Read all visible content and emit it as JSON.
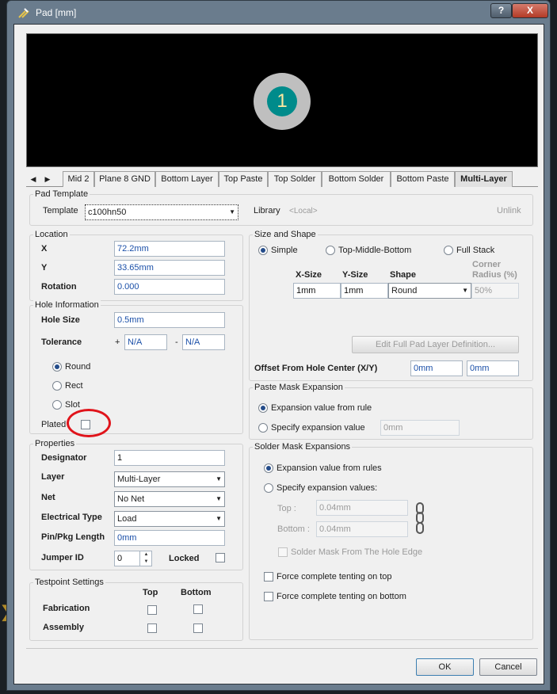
{
  "window": {
    "title": "Pad [mm]",
    "help_label": "?",
    "close_label": "X",
    "ok_label": "OK",
    "cancel_label": "Cancel"
  },
  "preview": {
    "pad_number": "1"
  },
  "tabs": {
    "items": [
      "Mid 2",
      "Plane 8 GND",
      "Bottom Layer",
      "Top Paste",
      "Top Solder",
      "Bottom Solder",
      "Bottom Paste",
      "Multi-Layer"
    ],
    "active": "Multi-Layer"
  },
  "pad_template": {
    "group": "Pad Template",
    "template_label": "Template",
    "template_value": "c100hn50",
    "library_label": "Library",
    "library_value": "<Local>",
    "unlink_label": "Unlink"
  },
  "location": {
    "group": "Location",
    "x_label": "X",
    "x_value": "72.2mm",
    "y_label": "Y",
    "y_value": "33.65mm",
    "rotation_label": "Rotation",
    "rotation_value": "0.000"
  },
  "hole": {
    "group": "Hole Information",
    "size_label": "Hole Size",
    "size_value": "0.5mm",
    "tolerance_label": "Tolerance",
    "plus": "+",
    "minus": "-",
    "tol_plus": "N/A",
    "tol_minus": "N/A",
    "round_label": "Round",
    "rect_label": "Rect",
    "slot_label": "Slot",
    "plated_label": "Plated",
    "selected": "Round",
    "plated": false
  },
  "properties": {
    "group": "Properties",
    "designator_label": "Designator",
    "designator_value": "1",
    "layer_label": "Layer",
    "layer_value": "Multi-Layer",
    "net_label": "Net",
    "net_value": "No Net",
    "etype_label": "Electrical Type",
    "etype_value": "Load",
    "pinpkg_label": "Pin/Pkg Length",
    "pinpkg_value": "0mm",
    "jumper_label": "Jumper ID",
    "jumper_value": "0",
    "locked_label": "Locked"
  },
  "testpoint": {
    "group": "Testpoint Settings",
    "top_label": "Top",
    "bottom_label": "Bottom",
    "fabrication_label": "Fabrication",
    "assembly_label": "Assembly"
  },
  "size_shape": {
    "group": "Size and Shape",
    "simple_label": "Simple",
    "tmb_label": "Top-Middle-Bottom",
    "full_label": "Full Stack",
    "xsize_header": "X-Size",
    "ysize_header": "Y-Size",
    "shape_header": "Shape",
    "corner_header_1": "Corner",
    "corner_header_2": "Radius (%)",
    "xsize_value": "1mm",
    "ysize_value": "1mm",
    "shape_value": "Round",
    "corner_value": "50%",
    "edit_full_label": "Edit Full Pad Layer Definition...",
    "offset_label": "Offset From Hole Center (X/Y)",
    "offset_x": "0mm",
    "offset_y": "0mm"
  },
  "paste_mask": {
    "group": "Paste Mask Expansion",
    "rule_label": "Expansion value from rule",
    "specify_label": "Specify expansion value",
    "value": "0mm"
  },
  "solder_mask": {
    "group": "Solder Mask Expansions",
    "rules_label": "Expansion value from rules",
    "specify_label": "Specify expansion values:",
    "top_label": "Top :",
    "top_value": "0.04mm",
    "bottom_label": "Bottom :",
    "bottom_value": "0.04mm",
    "hole_edge_label": "Solder Mask From The Hole Edge",
    "tent_top_label": "Force complete tenting on top",
    "tent_bottom_label": "Force complete tenting on bottom"
  },
  "colors": {
    "accent_blue": "#1a4fa8",
    "annotation_red": "#e0141b",
    "pad_teal": "#008b8b"
  }
}
